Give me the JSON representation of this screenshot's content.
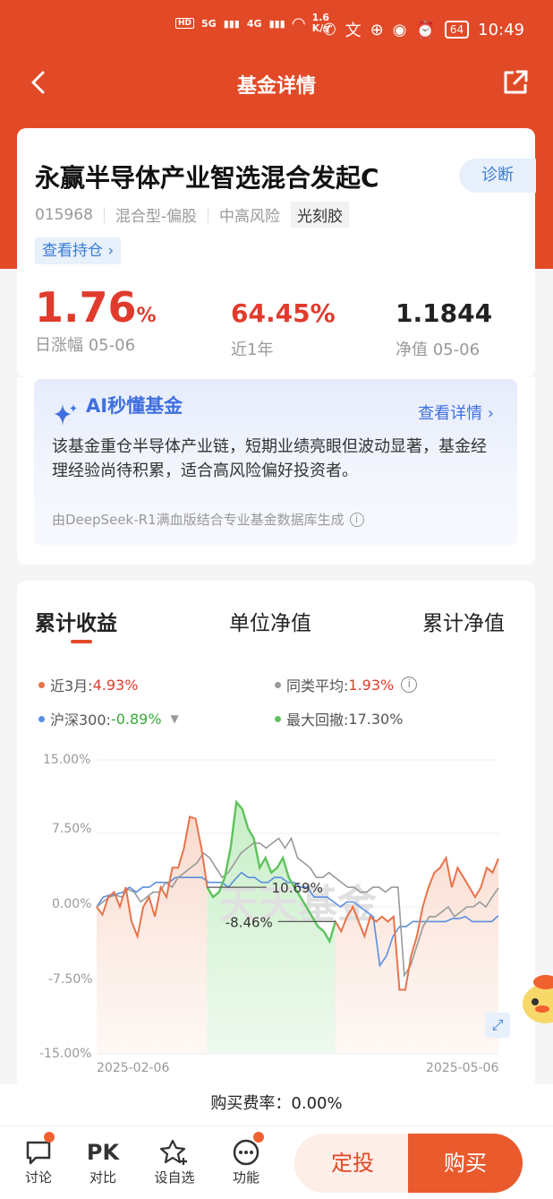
{
  "status": {
    "network_up": "1.6",
    "network_unit": "K/s",
    "battery": "64",
    "time": "10:49",
    "sig1": "5G",
    "sig2": "4G",
    "sig3": "6"
  },
  "nav": {
    "title": "基金详情"
  },
  "fund": {
    "name": "永赢半导体产业智选混合发起C",
    "code": "015968",
    "type": "混合型-偏股",
    "risk": "中高风险",
    "tag": "光刻胶",
    "diagnose_label": "诊断",
    "holdings_label": "查看持仓 ›",
    "day_change": "1.76",
    "day_change_unit": "%",
    "day_change_label": "日涨幅 05-06",
    "year_change": "64.45%",
    "year_change_label": "近1年",
    "nav_value": "1.1844",
    "nav_label": "净值 05-06"
  },
  "ai": {
    "title": "AI秒懂基金",
    "more": "查看详情 ›",
    "text": "该基金重仓半导体产业链，短期业绩亮眼但波动显著，基金经理经验尚待积累，适合高风险偏好投资者。",
    "footer": "由DeepSeek-R1满血版结合专业基金数据库生成"
  },
  "tabs": [
    "累计收益",
    "单位净值",
    "累计净值"
  ],
  "legend": {
    "fund_label": "近3月:",
    "fund_value": "4.93%",
    "peer_label": "同类平均:",
    "peer_value": "1.93%",
    "index_label": "沪深300:",
    "index_value": "-0.89%",
    "dd_label": "最大回撤:",
    "dd_value": "17.30%"
  },
  "colors": {
    "fund": "#e8734a",
    "peer": "#999999",
    "index": "#5a8fe0",
    "drawdown": "#5ec45e",
    "accent": "#e24a27"
  },
  "chart_data": {
    "type": "line",
    "ylim": [
      -15,
      15
    ],
    "yticks": [
      "15.00%",
      "7.50%",
      "0.00%",
      "-7.50%",
      "-15.00%"
    ],
    "x_start": "2025-02-06",
    "x_end": "2025-05-06",
    "watermark": "天天基金",
    "annot_max": "10.69%",
    "annot_min": "-8.46%",
    "drawdown_range": [
      19,
      41
    ],
    "series": [
      {
        "name": "近3月",
        "values": [
          0,
          -0.8,
          1,
          1.5,
          0,
          2,
          -1.5,
          -3,
          0,
          1,
          -1,
          2,
          1,
          4,
          4,
          6,
          9.2,
          9,
          6,
          2,
          1,
          1.5,
          3,
          6,
          10.69,
          10,
          8,
          7,
          4,
          5,
          3.5,
          4,
          5,
          3,
          2,
          1,
          0,
          -1,
          -2,
          -2.5,
          -3.5,
          -1.5,
          -2.5,
          -1,
          0,
          -1.5,
          -3,
          -1,
          -1.5,
          -1,
          -1.5,
          -1,
          -8.46,
          -8.46,
          -5,
          -3,
          0,
          2,
          3.5,
          4,
          5,
          2,
          4,
          3,
          2,
          1,
          2,
          4,
          3.5,
          4.93
        ]
      },
      {
        "name": "同类平均",
        "values": [
          0,
          0.5,
          1,
          1.2,
          1,
          1.8,
          1.5,
          0.5,
          1,
          1.5,
          1.5,
          2.5,
          2,
          3,
          3.5,
          4,
          4.5,
          5.5,
          5,
          4,
          3,
          3.5,
          4.5,
          5.5,
          6,
          6.5,
          6.5,
          6,
          6.5,
          7,
          6,
          7,
          5,
          4.5,
          4,
          3,
          3,
          3.5,
          3,
          2.5,
          2,
          2,
          1.5,
          1.5,
          2,
          2,
          1.5,
          2,
          2,
          -7,
          -6,
          -4,
          -2,
          -1,
          -1,
          -0.5,
          0,
          -1,
          -0.5,
          0,
          0,
          0.5,
          0,
          1,
          1.93
        ]
      },
      {
        "name": "沪深300",
        "values": [
          0,
          1,
          1.2,
          1.3,
          1.5,
          2,
          1.5,
          2,
          2,
          2.5,
          2.5,
          2.5,
          3,
          3,
          3,
          3,
          3,
          2.5,
          2.5,
          2.5,
          2,
          2.8,
          3.5,
          3,
          3,
          2.5,
          2.5,
          3,
          3,
          2.5,
          2.5,
          2,
          2,
          1,
          1,
          1,
          0.5,
          0,
          0.5,
          0.5,
          0,
          -0.5,
          -1,
          -6,
          -5,
          -3,
          -2,
          -2,
          -1.5,
          -1.5,
          -1.5,
          -1.5,
          -1.5,
          -1.5,
          -1.2,
          -1.2,
          -1,
          -1.5,
          -1.5,
          -1.5,
          -1.5,
          -0.89
        ]
      }
    ]
  },
  "fee": {
    "text": "购买费率：0.00%"
  },
  "bottom": {
    "items": [
      "讨论",
      "对比",
      "设自选",
      "功能"
    ],
    "pk": "PK",
    "fix_label": "定投",
    "buy_label": "购买"
  }
}
